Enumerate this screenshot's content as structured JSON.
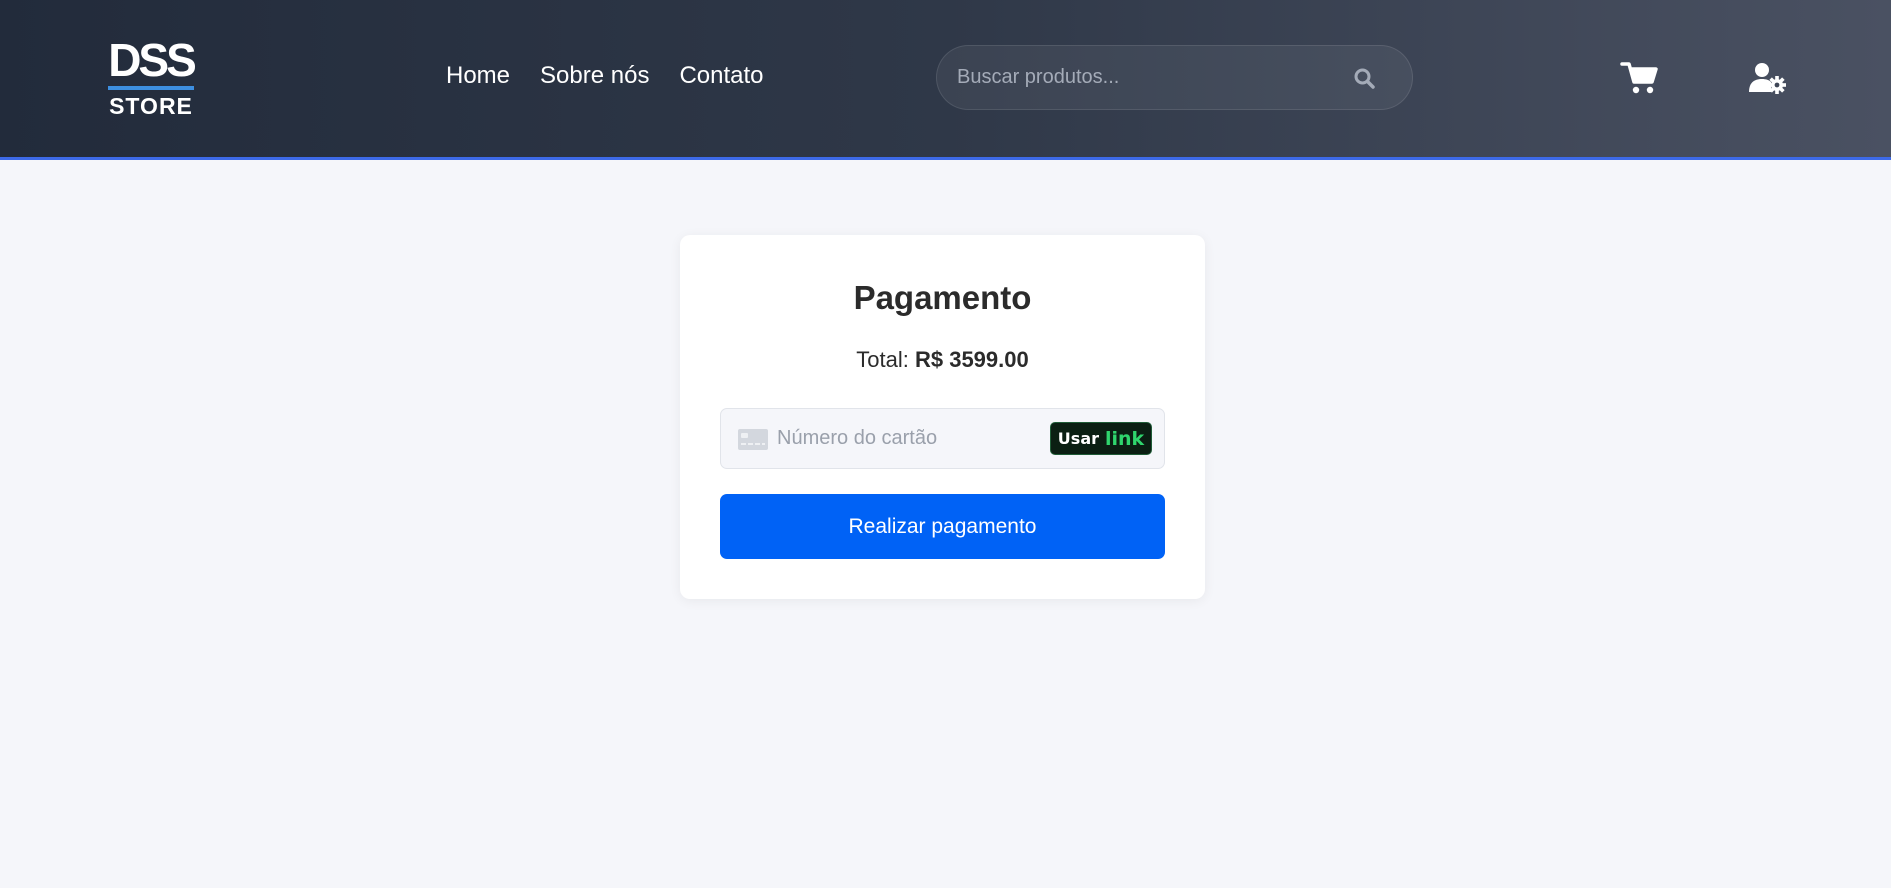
{
  "header": {
    "logo": {
      "top_text": "DSS",
      "bottom_text": "STORE",
      "icon": "dss-store-logo"
    },
    "nav": [
      {
        "label": "Home"
      },
      {
        "label": "Sobre nós"
      },
      {
        "label": "Contato"
      }
    ],
    "search": {
      "placeholder": "Buscar produtos...",
      "value": "",
      "icon": "search-icon"
    },
    "cart_icon": "cart-icon",
    "user_icon": "user-settings-icon"
  },
  "payment": {
    "title": "Pagamento",
    "total_label": "Total:",
    "total_value": "R$ 3599.00",
    "card_input": {
      "placeholder": "Número do cartão",
      "value": "",
      "icon": "credit-card-icon"
    },
    "link_button": {
      "usar": "Usar",
      "link": "link"
    },
    "pay_button": "Realizar pagamento"
  },
  "colors": {
    "accent_border": "#3d6ae8",
    "pay_button": "#0062f6",
    "link_green": "#2fd56d"
  }
}
